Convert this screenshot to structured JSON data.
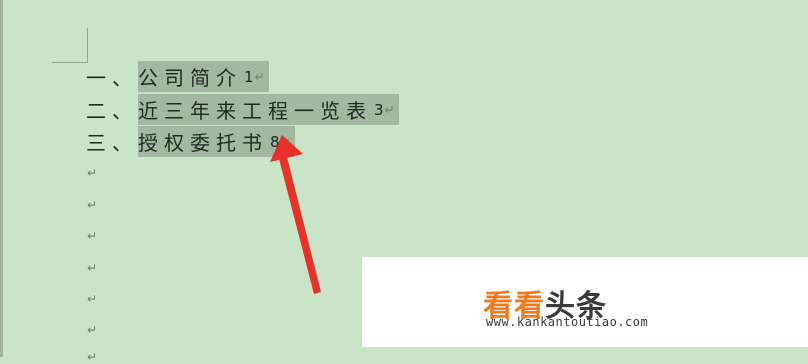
{
  "toc": {
    "items": [
      {
        "num": "一、",
        "title": "公司简介",
        "page": "1"
      },
      {
        "num": "二、",
        "title": "近三年来工程一览表",
        "page": "3"
      },
      {
        "num": "三、",
        "title": "授权委托书",
        "page": "8"
      }
    ]
  },
  "paragraph_mark": "↵",
  "watermark": {
    "brand_part1": "看看",
    "brand_part2": "头条",
    "url": "www.kankantoutiao.com"
  },
  "colors": {
    "background": "#c9e4c7",
    "selection": "#a3b8a0",
    "arrow": "#e8312a",
    "brand_orange": "#f07b1d"
  }
}
